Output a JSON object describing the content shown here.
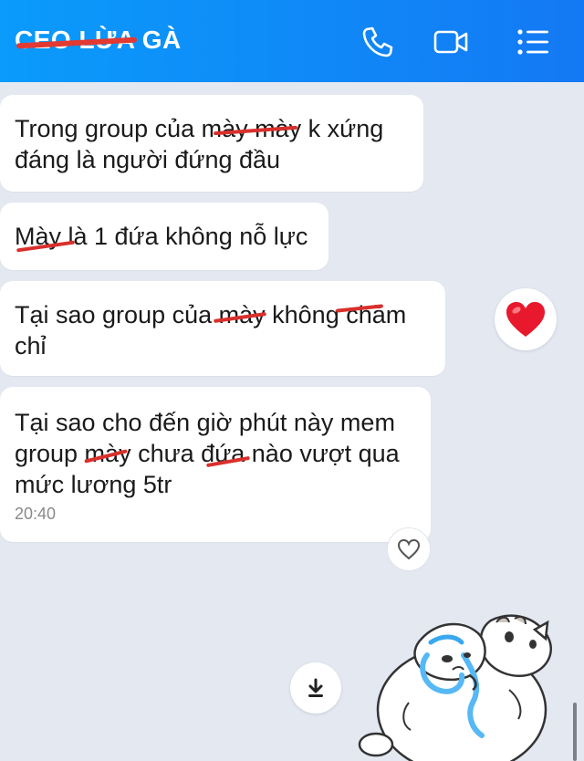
{
  "header": {
    "title": "CEO LỪA GÀ",
    "icons": [
      "phone-icon",
      "video-call-icon",
      "menu-list-icon"
    ],
    "colors": {
      "gradient_start": "#0a9bfb",
      "gradient_end": "#1479f4"
    }
  },
  "messages": [
    {
      "text": "Trong group của mày mày k xứng\nđáng là người đứng đầu"
    },
    {
      "text": "Mày là 1 đứa không nỗ lực"
    },
    {
      "text": "Tại sao group của mày không chăm\nchỉ",
      "reaction": "heart"
    },
    {
      "text": "Tại sao cho đến giờ phút này mem\ngroup mày chưa đứa nào vượt qua\nmức lương 5tr",
      "time": "20:40"
    }
  ],
  "colors": {
    "background": "#e3e8f1",
    "strike": "#d9302c",
    "heart": "#e8192c"
  }
}
